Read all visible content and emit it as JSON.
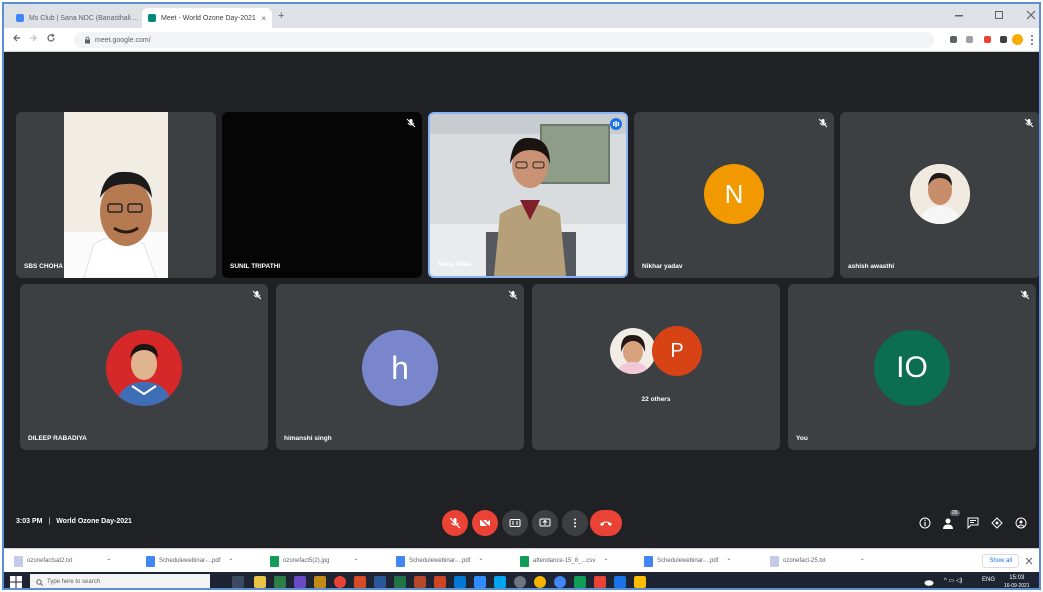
{
  "browser": {
    "tabs": [
      {
        "label": "Ms Club | Sana NDC (Banasthali ...",
        "active": false
      },
      {
        "label": "Meet - World Ozone Day-2021",
        "active": true
      }
    ],
    "url": "meet.google.com/",
    "new_tab": "+",
    "tab_close": "×"
  },
  "tiles_row1": [
    {
      "name": "SBS CHOHA",
      "type": "video-man"
    },
    {
      "name": "SUNIL TRIPATHI",
      "type": "black"
    },
    {
      "name": "Neha Pillai",
      "type": "video-woman"
    },
    {
      "name": "Nikhar yadav",
      "type": "avatar",
      "letter": "N",
      "color": "#f29900"
    },
    {
      "name": "ashish awasthi",
      "type": "photo-avatar"
    }
  ],
  "tiles_row2": [
    {
      "name": "DILEEP RABADIYA",
      "type": "photo-avatar-red"
    },
    {
      "name": "himanshi singh",
      "type": "avatar",
      "letter": "h",
      "color": "#7986cb"
    },
    {
      "name": "",
      "type": "others",
      "letter": "P",
      "color": "#d84315",
      "others_label": "22 others"
    },
    {
      "name": "You",
      "type": "avatar",
      "letter": "IO",
      "color": "#0b6e4f"
    }
  ],
  "meeting": {
    "time": "3:03 PM",
    "separator": "|",
    "title": "World Ozone Day-2021",
    "participant_count": "26"
  },
  "controls": {
    "accent": "#ea4335",
    "neutral": "#3c4043"
  },
  "downloads": [
    {
      "label": "ozonefactsat2.txt"
    },
    {
      "label": "Schedulewebinar-...pdf"
    },
    {
      "label": "ozonefact5(2).jpg"
    },
    {
      "label": "Schedulewebinar-...pdf"
    },
    {
      "label": "attendance-15_8_...csv"
    },
    {
      "label": "Schedulewebinar-...pdf"
    },
    {
      "label": "ozonefact-25.txt"
    }
  ],
  "show_all": "Show all",
  "taskbar": {
    "search_placeholder": "Type here to search",
    "tray_text": "ENG",
    "clock_time": "15:03",
    "clock_date": "16-09-2021"
  }
}
